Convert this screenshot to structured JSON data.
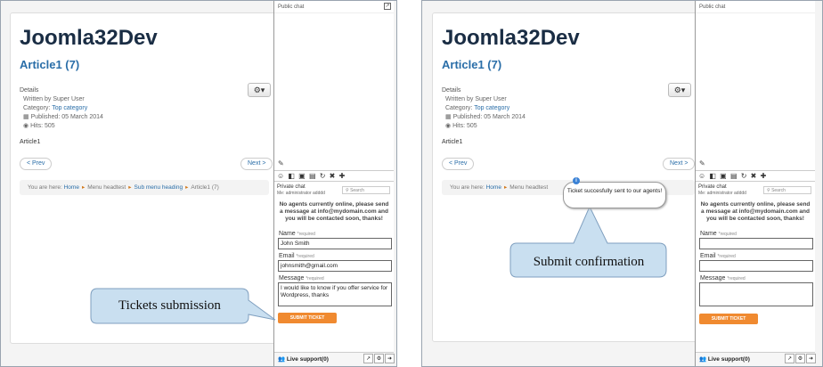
{
  "left": {
    "site_title": "Joomla32Dev",
    "article_title": "Article1 (7)",
    "details": {
      "heading": "Details",
      "written_by": "Written by Super User",
      "category_label": "Category:",
      "category_link": "Top category",
      "published": "Published: 05 March 2014",
      "hits": "Hits: 505"
    },
    "body": "Article1",
    "prev": "< Prev",
    "next": "Next >",
    "breadcrumb": {
      "prefix": "You are here:",
      "home": "Home",
      "menu": "Menu headtest",
      "sub": "Sub menu heading",
      "current": "Article1 (7)"
    },
    "chat": {
      "header": "Public chat",
      "private_title": "Private chat",
      "me": "Me: administrator adddd",
      "search_placeholder": "Search",
      "notice": "No agents currently online, please send a message at info@mydomain.com and you will be contacted soon, thanks!",
      "name_label": "Name",
      "name_value": "John Smith",
      "email_label": "Email",
      "email_value": "johnsmith@gmail.com",
      "message_label": "Message",
      "message_value": "I would like to know if you offer service for Wordpress, thanks",
      "required": "*required",
      "submit": "SUBMIT TICKET",
      "footer": "Live support(0)"
    },
    "callout": "Tickets submission"
  },
  "right": {
    "site_title": "Joomla32Dev",
    "article_title": "Article1 (7)",
    "details": {
      "heading": "Details",
      "written_by": "Written by Super User",
      "category_label": "Category:",
      "category_link": "Top category",
      "published": "Published: 05 March 2014",
      "hits": "Hits: 505"
    },
    "body": "Article1",
    "prev": "< Prev",
    "next": "Next >",
    "breadcrumb": {
      "prefix": "You are here:",
      "home": "Home",
      "menu": "Menu headtest"
    },
    "chat": {
      "header": "Public chat",
      "private_title": "Private chat",
      "me": "Me: administrator adddd",
      "search_placeholder": "Search",
      "notice": "No agents currently online, please send a message at info@mydomain.com and you will be contacted soon, thanks!",
      "name_label": "Name",
      "email_label": "Email",
      "message_label": "Message",
      "required": "*required",
      "submit": "SUBMIT TICKET",
      "footer": "Live support(0)"
    },
    "bubble": "Ticket succesfully sent to our agents!",
    "callout": "Submit confirmation"
  },
  "colors": {
    "accent": "#f08a30",
    "link": "#2a6ea8",
    "callout_fill": "#c9dff0"
  }
}
